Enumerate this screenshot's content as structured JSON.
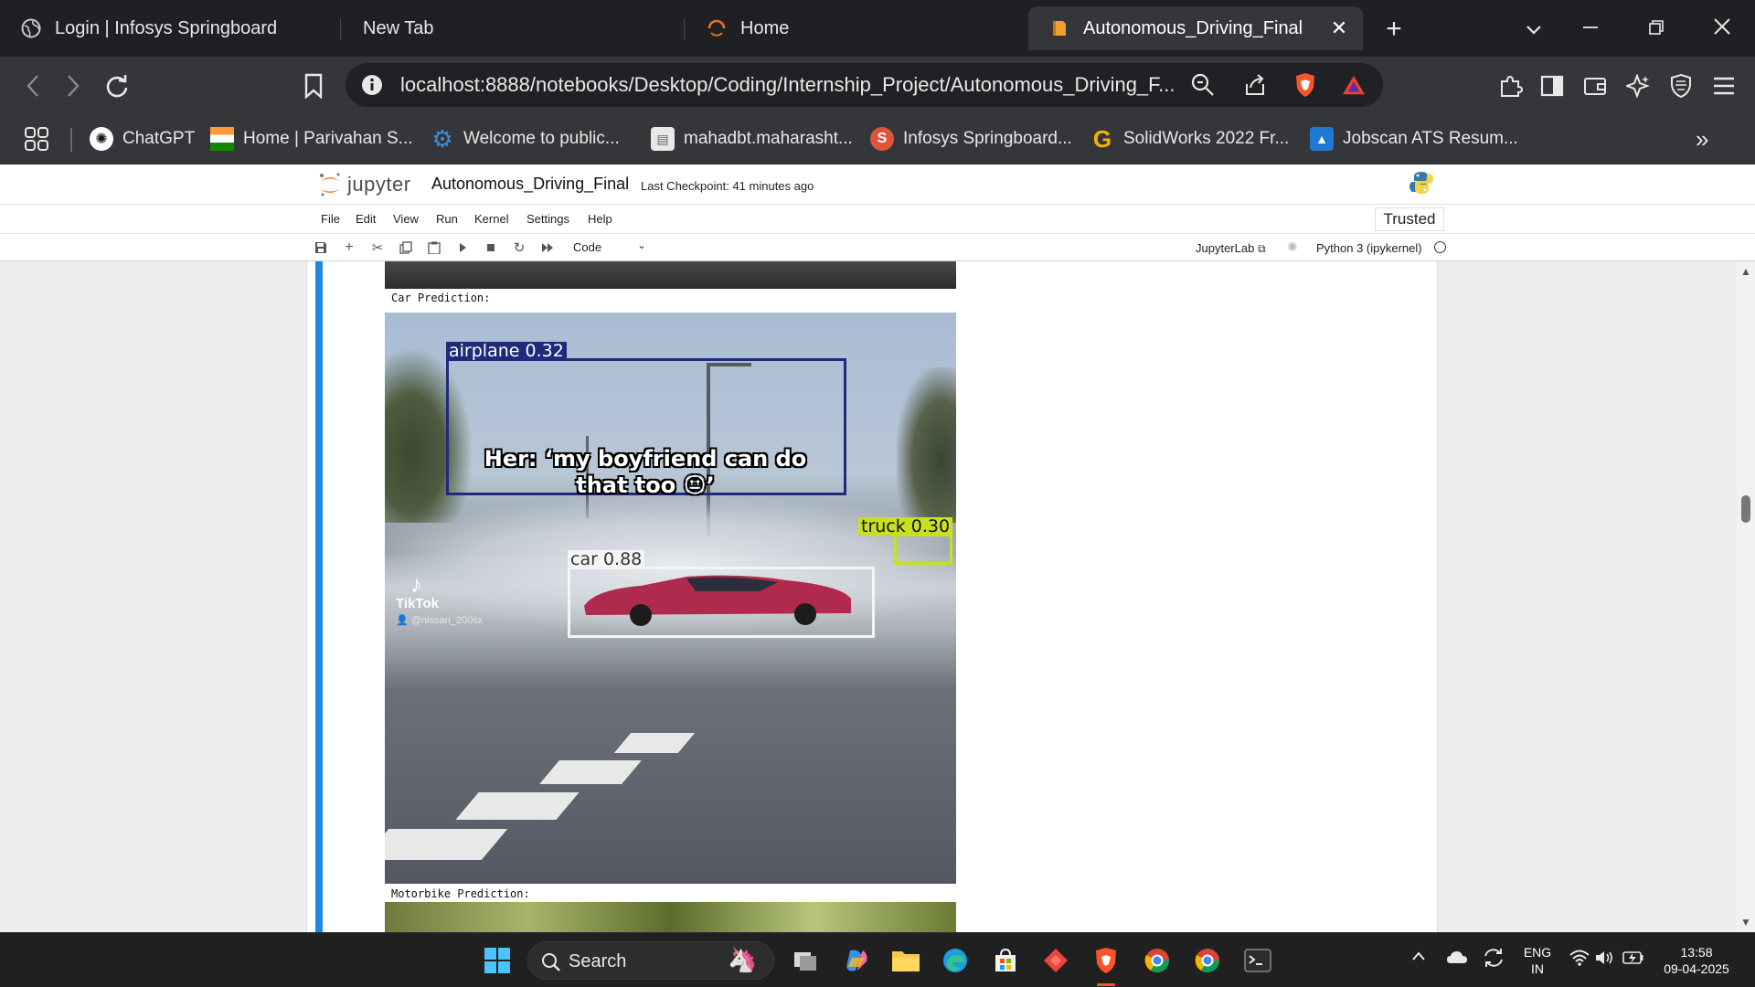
{
  "browser": {
    "tabs": [
      {
        "label": "Login | Infosys Springboard",
        "active": false
      },
      {
        "label": "New Tab",
        "active": false
      },
      {
        "label": "Home",
        "active": false
      },
      {
        "label": "Autonomous_Driving_Final",
        "active": true
      }
    ],
    "url": "localhost:8888/notebooks/Desktop/Coding/Internship_Project/Autonomous_Driving_F...",
    "bookmarks": [
      {
        "label": "ChatGPT",
        "icon": "chatgpt-icon"
      },
      {
        "label": "Home | Parivahan S...",
        "icon": "india-flag-icon"
      },
      {
        "label": "Welcome to public...",
        "icon": "gear-blue-icon"
      },
      {
        "label": "mahadbt.maharasht...",
        "icon": "document-icon"
      },
      {
        "label": "Infosys Springboard...",
        "icon": "springboard-icon"
      },
      {
        "label": "SolidWorks 2022 Fr...",
        "icon": "g-letter-icon"
      },
      {
        "label": "Jobscan ATS Resum...",
        "icon": "jobscan-icon"
      }
    ]
  },
  "jupyter": {
    "logo_text": "jupyter",
    "notebook_title": "Autonomous_Driving_Final",
    "checkpoint": "Last Checkpoint: 41 minutes ago",
    "menu": [
      "File",
      "Edit",
      "View",
      "Run",
      "Kernel",
      "Settings",
      "Help"
    ],
    "trusted": "Trusted",
    "cell_type": "Code",
    "jupyterlab_link": "JupyterLab",
    "kernel_name": "Python 3 (ipykernel)"
  },
  "output": {
    "car_label": "Car Prediction:",
    "motorbike_label": "Motorbike Prediction:",
    "caption_line1": "Her: ‘my boyfriend can do",
    "caption_line2": "that too 😐’",
    "watermark": "TikTok",
    "watermark_user": "@nissan_200sx",
    "detections": [
      {
        "label": "airplane 0.32",
        "color": "#1f2a7a"
      },
      {
        "label": "truck 0.30",
        "color": "#c8e020"
      },
      {
        "label": "car 0.88",
        "color": "#f5f5f5"
      }
    ]
  },
  "taskbar": {
    "search": "Search",
    "lang_line1": "ENG",
    "lang_line2": "IN",
    "time": "13:58",
    "date": "09-04-2025"
  }
}
